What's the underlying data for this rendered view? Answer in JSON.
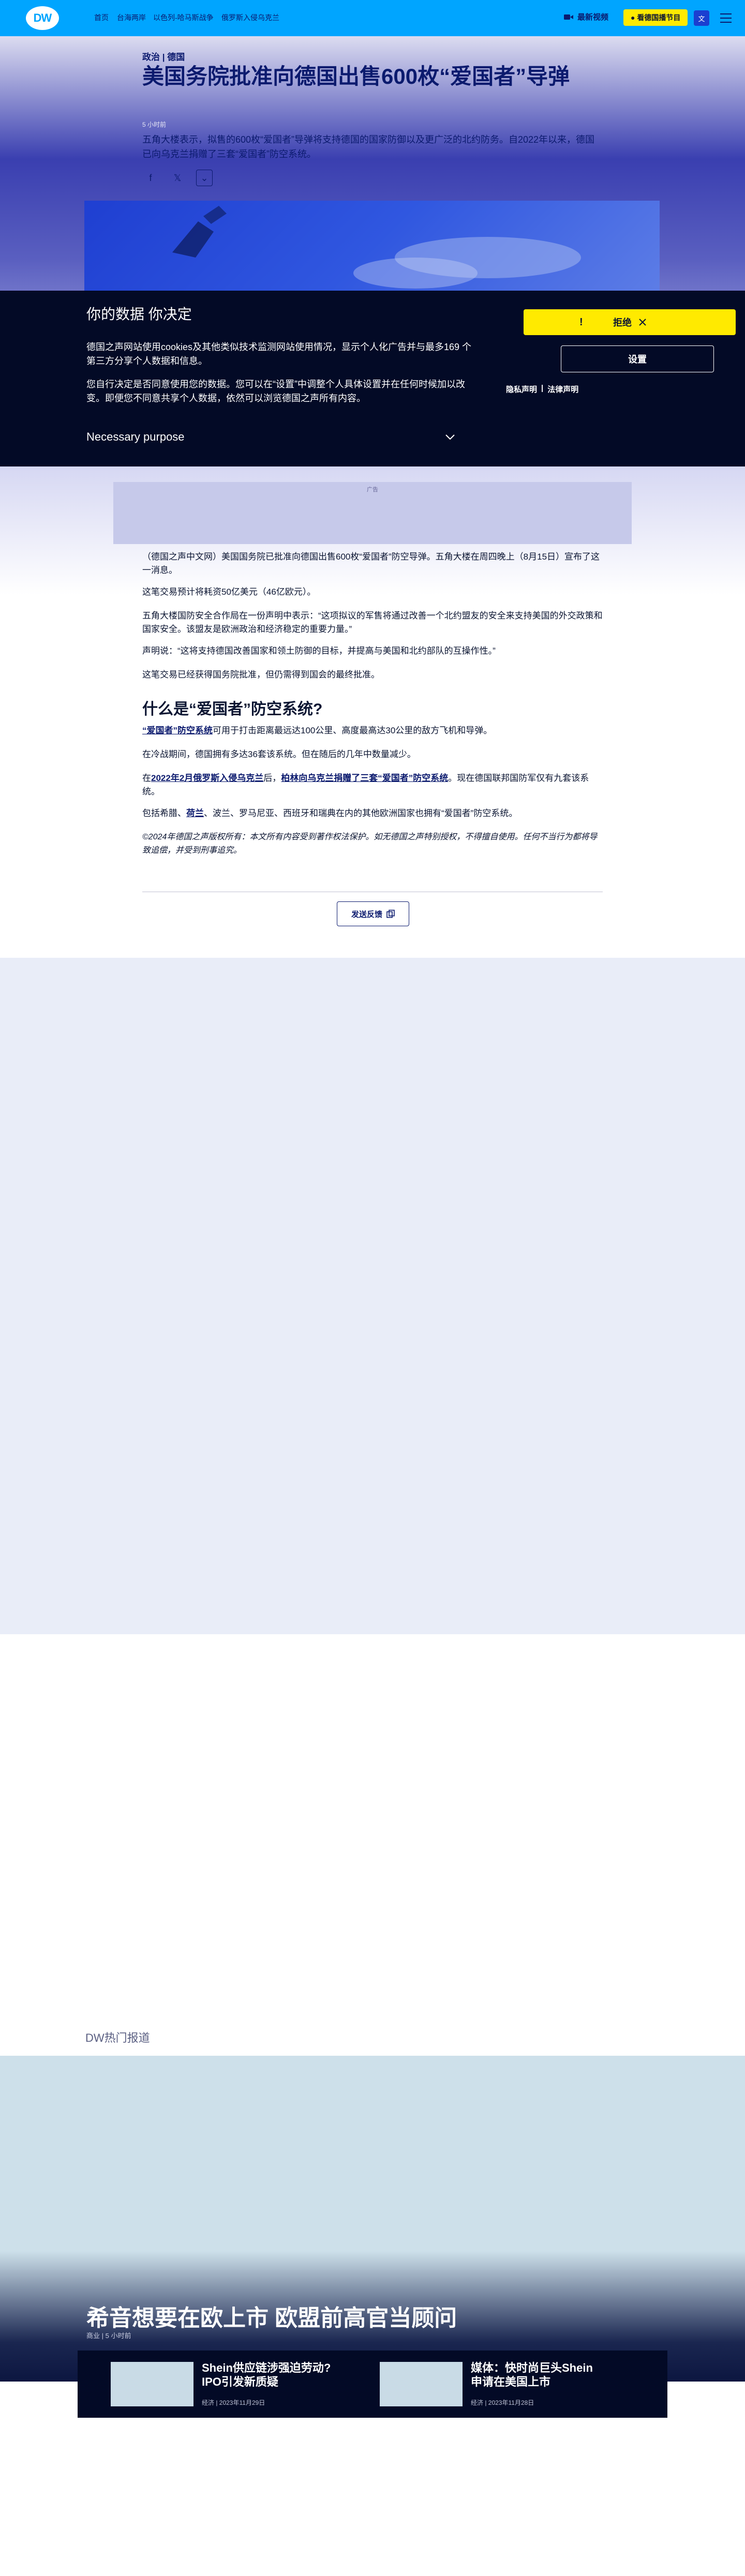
{
  "header": {
    "logo": "DW",
    "nav": [
      "首页",
      "台海两岸",
      "以色列-哈马斯战争",
      "俄罗斯入侵乌克兰"
    ],
    "latest_video": "最新视频",
    "live": "● 看德国播节目",
    "lang_icon": "文"
  },
  "article": {
    "section_tags": "政治 | 德国",
    "title": "美国务院批准向德国出售600枚“爱国者”导弹",
    "timestamp": "5 小时前",
    "summary": "五角大楼表示，拟售的600枚“爱国者”导弹将支持德国的国家防御以及更广泛的北约防务。自2022年以来，德国已向乌克兰捐赠了三套“爱国者”防空系统。",
    "share": [
      "f",
      "𝕏",
      "⌄"
    ],
    "ad_label": "广告",
    "paragraphs": [
      "（德国之声中文网）美国国务院已批准向德国出售600枚“爱国者”防空导弹。五角大楼在周四晚上（8月15日）宣布了这一消息。",
      "这笔交易预计将耗资50亿美元（46亿欧元）。",
      "五角大楼国防安全合作局在一份声明中表示：“这项拟议的军售将通过改善一个北约盟友的安全来支持美国的外交政策和国家安全。该盟友是欧洲政治和经济稳定的重要力量。”",
      "声明说：“这将支持德国改善国家和领土防御的目标，并提高与美国和北约部队的互操作性。”",
      "这笔交易已经获得国务院批准，但仍需得到国会的最终批准。"
    ],
    "subhead": "什么是“爱国者”防空系统?",
    "p6_link": "“爱国者”防空系统",
    "p6_rest": "可用于打击距离最远达100公里、高度最高达30公里的敌方飞机和导弹。",
    "p7": "在冷战期间，德国拥有多达36套该系统。但在随后的几年中数量减少。",
    "p8_a": "在",
    "p8_link1": "2022年2月俄罗斯入侵乌克兰",
    "p8_b": "后，",
    "p8_link2": "柏林向乌克兰捐赠了三套“爱国者”防空系统",
    "p8_c": "。现在德国联邦国防军仅有九套该系统。",
    "p9_a": "包括希腊、",
    "p9_link": "荷兰",
    "p9_b": "、波兰、罗马尼亚、西班牙和瑞典在内的其他欧洲国家也拥有“爱国者”防空系统。",
    "copyright": "©2024年德国之声版权所有：本文所有内容受到著作权法保护。如无德国之声特别授权，不得擅自使用。任何不当行为都将导致追偿，并受到刑事追究。",
    "feedback": "发送反馈"
  },
  "cookie": {
    "title": "你的数据 你决定",
    "p1": "德国之声网站使用cookies及其他类似技术监测网站使用情况，显示个人化广告并与最多169 个第三方分享个人数据和信息。",
    "p2": "您自行决定是否同意使用您的数据。您可以在“设置”中调整个人具体设置并在任何时候加以改变。即便您不同意共享个人数据，依然可以浏览德国之声所有内容。",
    "necessary": "Necessary purpose",
    "reject": "拒绝",
    "bang": "!",
    "settings": "设置",
    "privacy": "隐私声明",
    "sep": "|",
    "legal": "法律声明"
  },
  "hot": {
    "label": "DW热门报道",
    "feature_title": "希音想要在欧上市 欧盟前高官当顾问",
    "feature_meta": "商业 | 5 小时前",
    "cards": [
      {
        "title": "Shein供应链涉强迫劳动? IPO引发新质疑",
        "meta": "经济 | 2023年11月29日"
      },
      {
        "title": "媒体：快时尚巨头Shein申请在美国上市",
        "meta": "经济 | 2023年11月28日"
      }
    ]
  }
}
